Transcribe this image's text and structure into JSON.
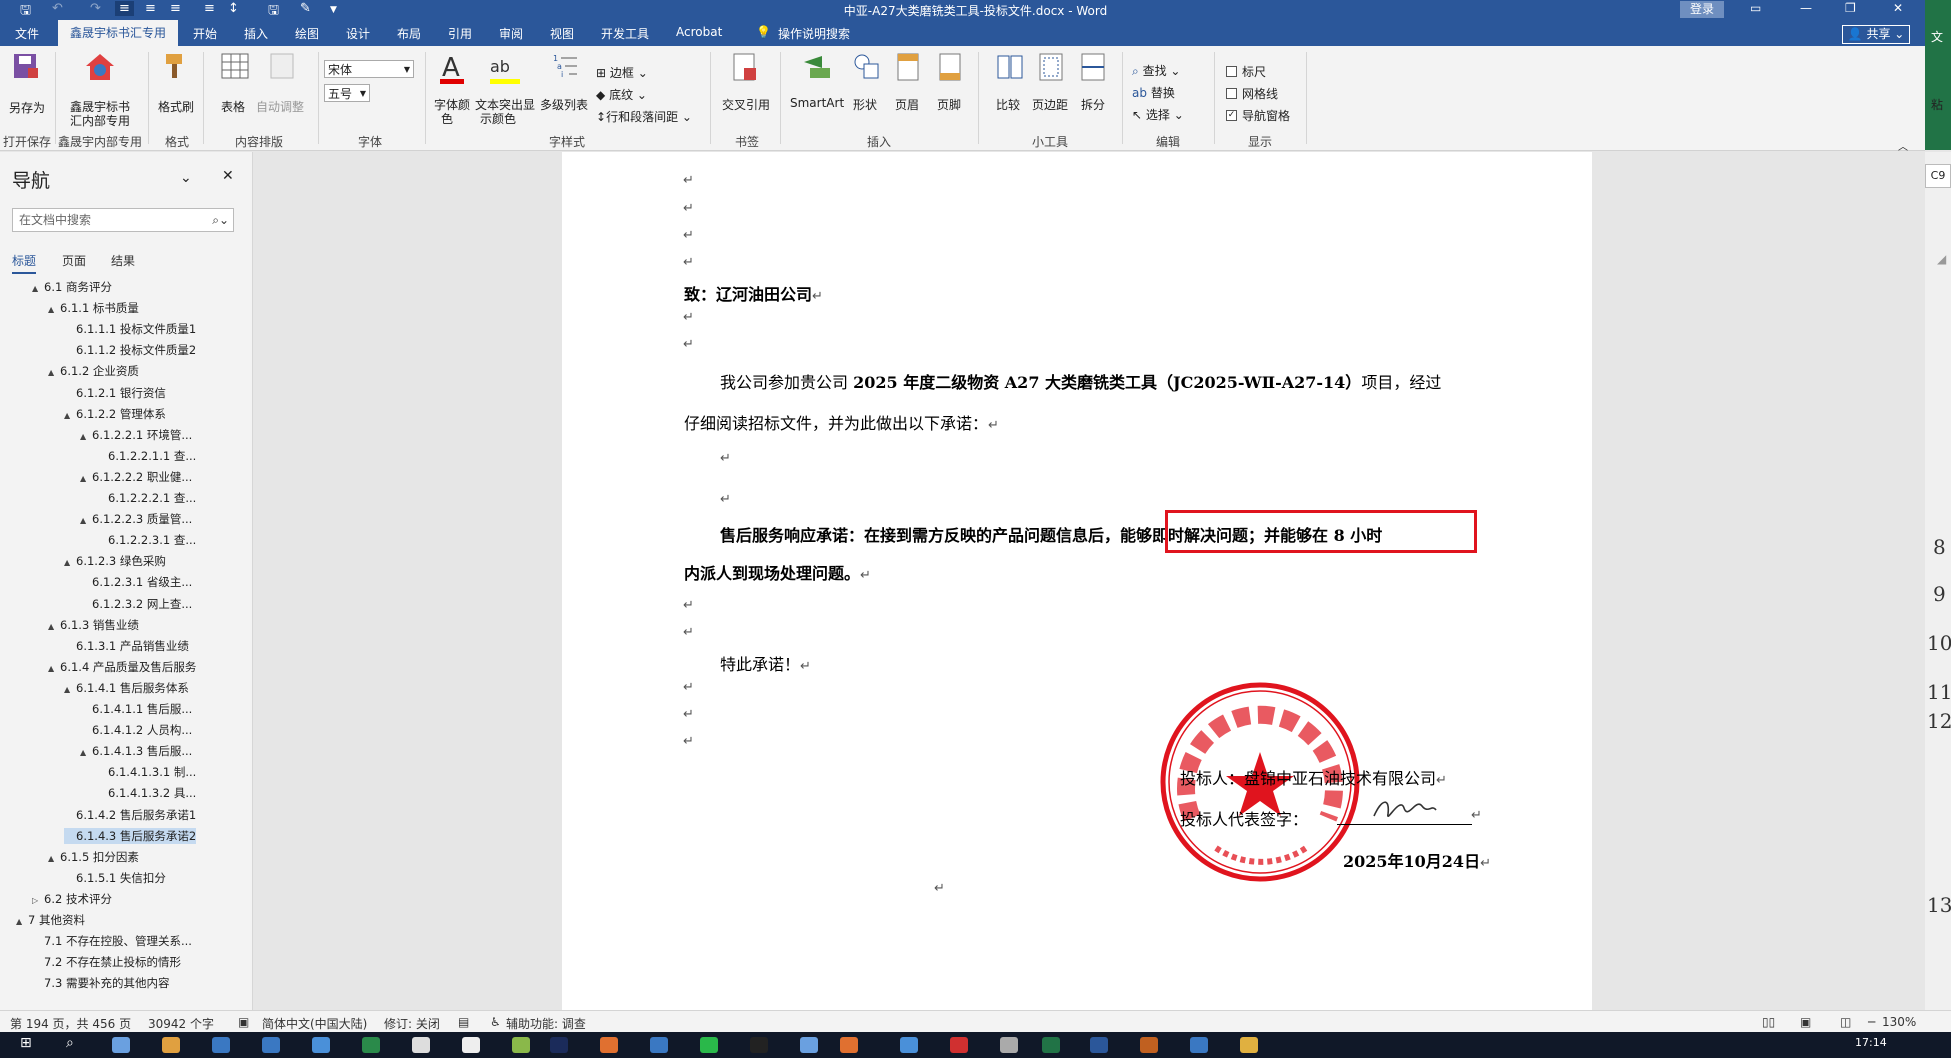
{
  "window": {
    "title": "中亚-A27大类磨铣类工具-投标文件.docx - Word",
    "login": "登录"
  },
  "tabs": [
    "文件",
    "鑫晟宇标书汇专用",
    "开始",
    "插入",
    "绘图",
    "设计",
    "布局",
    "引用",
    "审阅",
    "视图",
    "开发工具",
    "Acrobat",
    "操作说明搜索"
  ],
  "share": "共享",
  "ribbon": {
    "save_as": "另存为",
    "xsy_inner_l1": "鑫晟宇标书",
    "xsy_inner_l2": "汇内部专用",
    "format_painter": "格式刷",
    "table": "表格",
    "auto_adjust": "自动调整",
    "font_name": "宋体",
    "font_size": "五号",
    "font_color_l1": "字体颜",
    "font_color_l2": "色",
    "text_highlight_l1": "文本突出显",
    "text_highlight_l2": "示颜色",
    "multilevel_list": "多级列表",
    "border": "边框",
    "shading": "底纹",
    "line_spacing": "行和段落间距",
    "cross_ref": "交叉引用",
    "smartart": "SmartArt",
    "shapes": "形状",
    "header": "页眉",
    "footer": "页脚",
    "compare": "比较",
    "margins": "页边距",
    "split": "拆分",
    "find": "查找",
    "replace": "替换",
    "select": "选择",
    "ruler": "标尺",
    "gridlines": "网格线",
    "nav_pane": "导航窗格",
    "paste": "粘",
    "groups": {
      "open_save": "打开保存",
      "xsy_inner": "鑫晟宇内部专用",
      "format": "格式",
      "content_layout": "内容排版",
      "font": "字体",
      "font_style": "字样式",
      "bookmark": "书签",
      "insert": "插入",
      "tools": "小工具",
      "edit": "编辑",
      "display": "显示"
    }
  },
  "nav": {
    "title": "导航",
    "search_placeholder": "在文档中搜索",
    "tabs": [
      "标题",
      "页面",
      "结果"
    ],
    "tree": [
      {
        "t": "6.1 商务评分",
        "lvl": 2,
        "tw": "▲"
      },
      {
        "t": "6.1.1 标书质量",
        "lvl": 3,
        "tw": "▲"
      },
      {
        "t": "6.1.1.1 投标文件质量1",
        "lvl": 4,
        "tw": ""
      },
      {
        "t": "6.1.1.2 投标文件质量2",
        "lvl": 4,
        "tw": ""
      },
      {
        "t": "6.1.2 企业资质",
        "lvl": 3,
        "tw": "▲"
      },
      {
        "t": "6.1.2.1 银行资信",
        "lvl": 4,
        "tw": ""
      },
      {
        "t": "6.1.2.2 管理体系",
        "lvl": 4,
        "tw": "▲"
      },
      {
        "t": "6.1.2.2.1 环境管...",
        "lvl": 5,
        "tw": "▲"
      },
      {
        "t": "6.1.2.2.1.1 查...",
        "lvl": 6,
        "tw": ""
      },
      {
        "t": "6.1.2.2.2 职业健...",
        "lvl": 5,
        "tw": "▲"
      },
      {
        "t": "6.1.2.2.2.1 查...",
        "lvl": 6,
        "tw": ""
      },
      {
        "t": "6.1.2.2.3 质量管...",
        "lvl": 5,
        "tw": "▲"
      },
      {
        "t": "6.1.2.2.3.1 查...",
        "lvl": 6,
        "tw": ""
      },
      {
        "t": "6.1.2.3 绿色采购",
        "lvl": 4,
        "tw": "▲"
      },
      {
        "t": "6.1.2.3.1 省级主...",
        "lvl": 5,
        "tw": ""
      },
      {
        "t": "6.1.2.3.2 网上查...",
        "lvl": 5,
        "tw": ""
      },
      {
        "t": "6.1.3 销售业绩",
        "lvl": 3,
        "tw": "▲"
      },
      {
        "t": "6.1.3.1 产品销售业绩",
        "lvl": 4,
        "tw": ""
      },
      {
        "t": "6.1.4 产品质量及售后服务",
        "lvl": 3,
        "tw": "▲"
      },
      {
        "t": "6.1.4.1 售后服务体系",
        "lvl": 4,
        "tw": "▲"
      },
      {
        "t": "6.1.4.1.1 售后服...",
        "lvl": 5,
        "tw": ""
      },
      {
        "t": "6.1.4.1.2 人员构...",
        "lvl": 5,
        "tw": ""
      },
      {
        "t": "6.1.4.1.3 售后服...",
        "lvl": 5,
        "tw": "▲"
      },
      {
        "t": "6.1.4.1.3.1 制...",
        "lvl": 6,
        "tw": ""
      },
      {
        "t": "6.1.4.1.3.2 具...",
        "lvl": 6,
        "tw": ""
      },
      {
        "t": "6.1.4.2 售后服务承诺1",
        "lvl": 4,
        "tw": ""
      },
      {
        "t": "6.1.4.3 售后服务承诺2",
        "lvl": 4,
        "tw": "",
        "selected": true
      },
      {
        "t": "6.1.5 扣分因素",
        "lvl": 3,
        "tw": "▲"
      },
      {
        "t": "6.1.5.1 失信扣分",
        "lvl": 4,
        "tw": ""
      },
      {
        "t": "6.2 技术评分",
        "lvl": 2,
        "tw": "▷"
      },
      {
        "t": "7 其他资料",
        "lvl": 1,
        "tw": "▲"
      },
      {
        "t": "7.1 不存在控股、管理关系...",
        "lvl": 2,
        "tw": ""
      },
      {
        "t": "7.2 不存在禁止投标的情形",
        "lvl": 2,
        "tw": ""
      },
      {
        "t": "7.3 需要补充的其他内容",
        "lvl": 2,
        "tw": ""
      }
    ]
  },
  "doc": {
    "to_line": "致：辽河油田公司",
    "p1_a": "我公司参加贵公司 ",
    "p1_b": "2025 年度二级物资 A27 大类磨铣类工具（JC2025-WⅡ-A27-14）",
    "p1_c": "项目，经过",
    "p2": "仔细阅读招标文件，并为此做出以下承诺：",
    "p3_a": "售后服务响应承诺：在接到需方反映的产品问题信息后，",
    "p3_b": "能够即时解决问题；并能够在 8 小时",
    "p4": "内派人到现场处理问题。",
    "special": "特此承诺！",
    "bidder": "投标人：盘锦中亚石油技术有限公司",
    "rep": "投标人代表签字：",
    "date": "2025年10月24日",
    "mark": "↵"
  },
  "right_ruler": [
    "C9",
    "8",
    "9",
    "10",
    "11",
    "12",
    "13"
  ],
  "status": {
    "page": "第 194 页，共 456 页",
    "words": "30942 个字",
    "lang": "简体中文(中国大陆)",
    "track": "修订: 关闭",
    "access": "辅助功能: 调查",
    "zoom": "130%"
  },
  "clock": "17:14",
  "colors": {
    "accent": "#2b579a",
    "highlight_box": "#e0141e",
    "stamp": "#e0141e"
  }
}
